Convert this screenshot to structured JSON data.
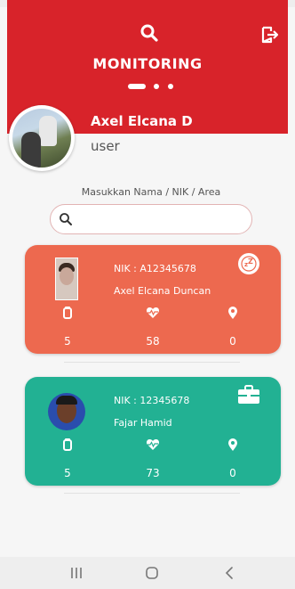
{
  "header": {
    "title": "MONITORING",
    "color": "#d8232a"
  },
  "profile": {
    "name": "Axel Elcana D",
    "role": "user"
  },
  "search": {
    "label": "Masukkan Nama / NIK / Area",
    "value": "",
    "placeholder": ""
  },
  "cards": [
    {
      "nik": "NIK : A12345678",
      "name": "Axel Elcana Duncan",
      "status_icon": "sleep-icon",
      "color": "#ed694f",
      "stats": {
        "battery": "5",
        "heart_rate": "58",
        "location": "0"
      }
    },
    {
      "nik": "NIK : 12345678",
      "name": "Fajar Hamid",
      "status_icon": "briefcase-icon",
      "color": "#22b193",
      "stats": {
        "battery": "5",
        "heart_rate": "73",
        "location": "0"
      }
    }
  ],
  "nav": {
    "icons": [
      "recent-apps-icon",
      "home-icon",
      "back-icon"
    ]
  }
}
